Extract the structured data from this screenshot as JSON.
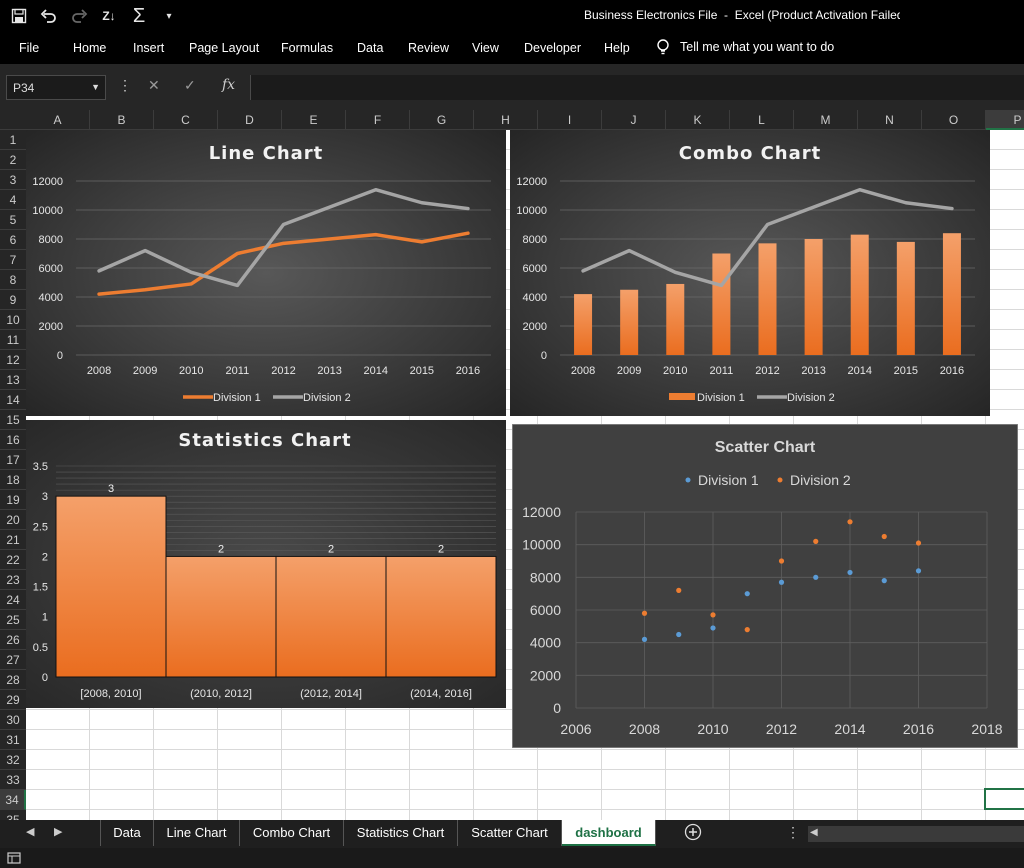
{
  "window": {
    "title": "Business Electronics File  -  Excel (Product Activation Failed)"
  },
  "qat_icons": [
    "save-icon",
    "undo-icon",
    "redo-icon",
    "sort-icon",
    "sum-icon",
    "customize-icon"
  ],
  "menu": {
    "file": "File",
    "home": "Home",
    "insert": "Insert",
    "page_layout": "Page Layout",
    "formulas": "Formulas",
    "data": "Data",
    "review": "Review",
    "view": "View",
    "developer": "Developer",
    "help": "Help",
    "tell_me": "Tell me what you want to do"
  },
  "formula_bar": {
    "name_box": "P34",
    "fx": "fx",
    "value": ""
  },
  "columns": [
    "A",
    "B",
    "C",
    "D",
    "E",
    "F",
    "G",
    "H",
    "I",
    "J",
    "K",
    "L",
    "M",
    "N",
    "O",
    "P"
  ],
  "rows": [
    "1",
    "2",
    "3",
    "4",
    "5",
    "6",
    "7",
    "8",
    "9",
    "10",
    "11",
    "12",
    "13",
    "14",
    "15",
    "16",
    "17",
    "18",
    "19",
    "20",
    "21",
    "22",
    "23",
    "24",
    "25",
    "26",
    "27",
    "28",
    "29",
    "30",
    "31",
    "32",
    "33",
    "34",
    "35"
  ],
  "sheet_tabs": {
    "tabs": [
      "Data",
      "Line Chart",
      "Combo Chart",
      "Statistics Chart",
      "Scatter Chart",
      "dashboard"
    ],
    "active": "dashboard"
  },
  "colors": {
    "orange": "#ed7d31",
    "gray": "#a5a5a5",
    "blue": "#5b9bd5",
    "excel_green": "#1e7145"
  },
  "chart_data": [
    {
      "type": "line",
      "title": "Line Chart",
      "categories": [
        "2008",
        "2009",
        "2010",
        "2011",
        "2012",
        "2013",
        "2014",
        "2015",
        "2016"
      ],
      "ylim": [
        0,
        12000
      ],
      "yticks": [
        "0",
        "2000",
        "4000",
        "6000",
        "8000",
        "10000",
        "12000"
      ],
      "series": [
        {
          "name": "Division 1",
          "values": [
            4200,
            4500,
            4900,
            7000,
            7700,
            8000,
            8300,
            7800,
            8400
          ]
        },
        {
          "name": "Division 2",
          "values": [
            5800,
            7200,
            5700,
            4800,
            9000,
            10200,
            11400,
            10500,
            10100
          ]
        }
      ],
      "legend": "bottom"
    },
    {
      "type": "bar",
      "title": "Combo Chart",
      "categories": [
        "2008",
        "2009",
        "2010",
        "2011",
        "2012",
        "2013",
        "2014",
        "2015",
        "2016"
      ],
      "ylim": [
        0,
        12000
      ],
      "yticks": [
        "0",
        "2000",
        "4000",
        "6000",
        "8000",
        "10000",
        "12000"
      ],
      "series": [
        {
          "name": "Division 1",
          "kind": "bar",
          "values": [
            4200,
            4500,
            4900,
            7000,
            7700,
            8000,
            8300,
            7800,
            8400
          ]
        },
        {
          "name": "Division 2",
          "kind": "line",
          "values": [
            5800,
            7200,
            5700,
            4800,
            9000,
            10200,
            11400,
            10500,
            10100
          ]
        }
      ],
      "legend": "bottom"
    },
    {
      "type": "bar",
      "title": "Statistics Chart",
      "categories": [
        "[2008, 2010]",
        "(2010, 2012]",
        "(2012, 2014]",
        "(2014, 2016]"
      ],
      "values": [
        3,
        2,
        2,
        2
      ],
      "data_labels": [
        "3",
        "2",
        "2",
        "2"
      ],
      "ylim": [
        0,
        3.5
      ],
      "yticks": [
        "0",
        "0.5",
        "1",
        "1.5",
        "2",
        "2.5",
        "3",
        "3.5"
      ]
    },
    {
      "type": "scatter",
      "title": "Scatter Chart",
      "xlim": [
        2006,
        2018
      ],
      "ylim": [
        0,
        12000
      ],
      "xticks": [
        "2006",
        "2008",
        "2010",
        "2012",
        "2014",
        "2016",
        "2018"
      ],
      "yticks": [
        "0",
        "2000",
        "4000",
        "6000",
        "8000",
        "10000",
        "12000"
      ],
      "series": [
        {
          "name": "Division 1",
          "points": [
            [
              2008,
              4200
            ],
            [
              2009,
              4500
            ],
            [
              2010,
              4900
            ],
            [
              2011,
              7000
            ],
            [
              2012,
              7700
            ],
            [
              2013,
              8000
            ],
            [
              2014,
              8300
            ],
            [
              2015,
              7800
            ],
            [
              2016,
              8400
            ]
          ]
        },
        {
          "name": "Division 2",
          "points": [
            [
              2008,
              5800
            ],
            [
              2009,
              7200
            ],
            [
              2010,
              5700
            ],
            [
              2011,
              4800
            ],
            [
              2012,
              9000
            ],
            [
              2013,
              10200
            ],
            [
              2014,
              11400
            ],
            [
              2015,
              10500
            ],
            [
              2016,
              10100
            ]
          ]
        }
      ],
      "legend": "top",
      "grid": true
    }
  ]
}
